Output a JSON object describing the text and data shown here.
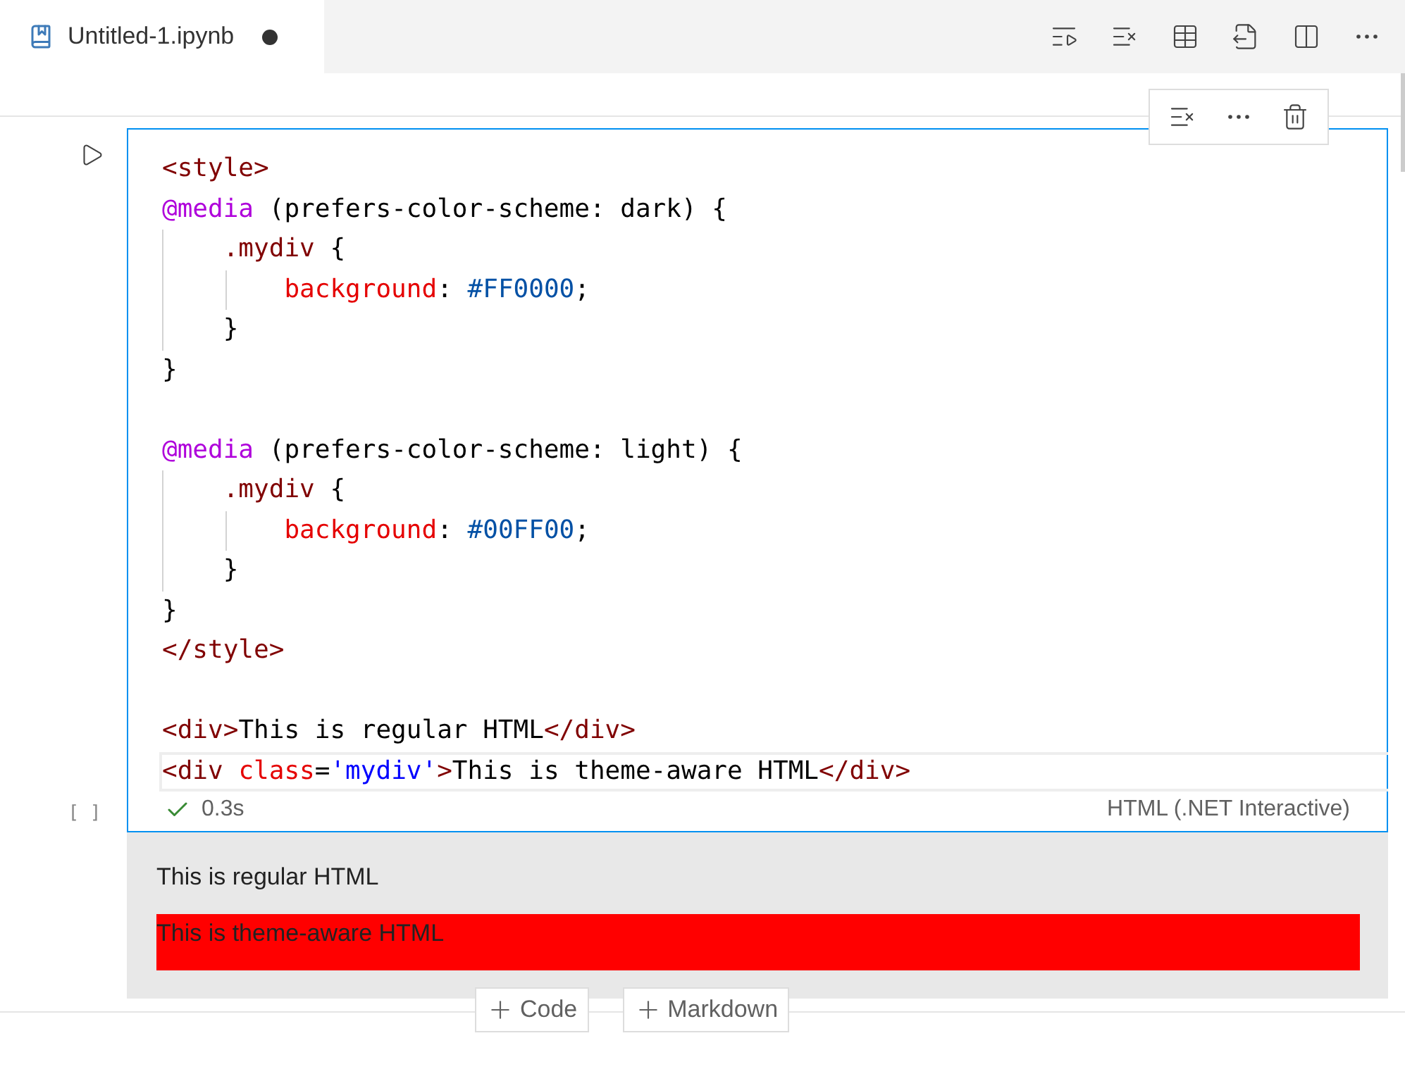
{
  "tab": {
    "title": "Untitled-1.ipynb",
    "dirty": true
  },
  "cell": {
    "execution": "[ ]",
    "selected": true,
    "blocks": [
      [
        [
          {
            "kind": "tag",
            "text": "<style>"
          }
        ],
        [
          {
            "kind": "at",
            "text": "@media"
          },
          {
            "kind": "plain",
            "text": " (prefers-color-scheme: dark) {"
          }
        ],
        [
          {
            "kind": "tag",
            "text": "    .mydiv"
          },
          {
            "kind": "plain",
            "text": " {"
          }
        ],
        [
          {
            "kind": "prop",
            "text": "        background"
          },
          {
            "kind": "plain",
            "text": ": "
          },
          {
            "kind": "value",
            "text": "#FF0000"
          },
          {
            "kind": "plain",
            "text": ";"
          }
        ],
        [
          {
            "kind": "plain",
            "text": "    }"
          }
        ],
        [
          {
            "kind": "plain",
            "text": "}"
          }
        ]
      ],
      [
        [
          {
            "kind": "at",
            "text": "@media"
          },
          {
            "kind": "plain",
            "text": " (prefers-color-scheme: light) {"
          }
        ],
        [
          {
            "kind": "tag",
            "text": "    .mydiv"
          },
          {
            "kind": "plain",
            "text": " {"
          }
        ],
        [
          {
            "kind": "prop",
            "text": "        background"
          },
          {
            "kind": "plain",
            "text": ": "
          },
          {
            "kind": "value",
            "text": "#00FF00"
          },
          {
            "kind": "plain",
            "text": ";"
          }
        ],
        [
          {
            "kind": "plain",
            "text": "    }"
          }
        ],
        [
          {
            "kind": "plain",
            "text": "}"
          }
        ],
        [
          {
            "kind": "tag",
            "text": "</style>"
          }
        ]
      ],
      [
        [
          {
            "kind": "tag",
            "text": "<div>"
          },
          {
            "kind": "plain",
            "text": "This is regular HTML"
          },
          {
            "kind": "tag",
            "text": "</div>"
          }
        ],
        [
          {
            "kind": "tag",
            "text": "<div "
          },
          {
            "kind": "prop",
            "text": "class"
          },
          {
            "kind": "plain",
            "text": "="
          },
          {
            "kind": "string",
            "text": "'mydiv'"
          },
          {
            "kind": "tag",
            "text": ">"
          },
          {
            "kind": "plain",
            "text": "This is theme-aware HTML"
          },
          {
            "kind": "tag",
            "text": "</div>"
          }
        ]
      ]
    ],
    "status": {
      "success": true,
      "time": "0.3s",
      "language": "HTML (.NET Interactive)"
    },
    "output": [
      {
        "kind": "plain",
        "text": "This is regular HTML"
      },
      {
        "kind": "block",
        "text": "This is theme-aware HTML",
        "color": "#ff0000"
      }
    ]
  },
  "add_buttons": [
    "Code",
    "Markdown"
  ]
}
